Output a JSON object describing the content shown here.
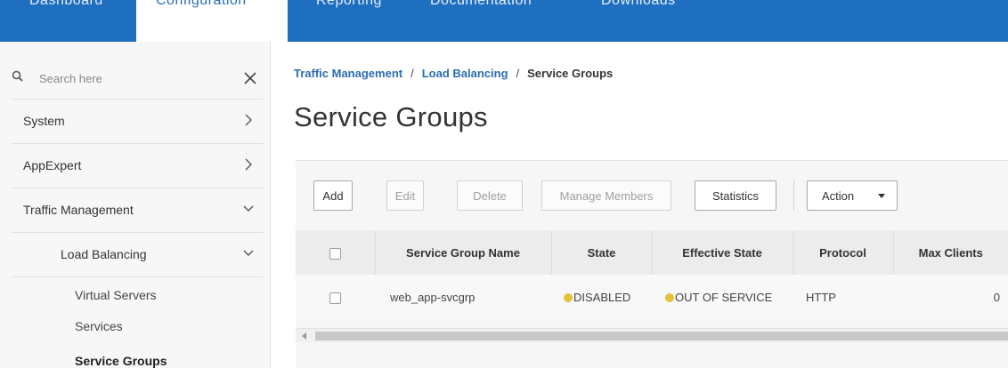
{
  "top_nav": {
    "tabs": [
      {
        "label": "Dashboard"
      },
      {
        "label": "Configuration"
      },
      {
        "label": "Reporting"
      },
      {
        "label": "Documentation"
      },
      {
        "label": "Downloads"
      }
    ],
    "active_tab": "Configuration",
    "background_color": "#1e6fbf"
  },
  "sidebar": {
    "search": {
      "placeholder": "Search here",
      "value": ""
    },
    "items": [
      {
        "label": "System",
        "expanded": false
      },
      {
        "label": "AppExpert",
        "expanded": false
      },
      {
        "label": "Traffic Management",
        "expanded": true
      },
      {
        "label": "Load Balancing",
        "expanded": true
      }
    ],
    "sub_items": [
      {
        "label": "Virtual Servers"
      },
      {
        "label": "Services"
      },
      {
        "label": "Service Groups",
        "active": true
      }
    ]
  },
  "breadcrumb": {
    "items": [
      "Traffic Management",
      "Load Balancing",
      "Service Groups"
    ],
    "separator": "/"
  },
  "page": {
    "title": "Service Groups"
  },
  "toolbar": {
    "add": "Add",
    "edit": "Edit",
    "delete": "Delete",
    "manage_members": "Manage Members",
    "statistics": "Statistics",
    "action": "Action"
  },
  "table": {
    "columns": [
      "",
      "Service Group Name",
      "State",
      "Effective State",
      "Protocol",
      "Max Clients"
    ],
    "rows": [
      {
        "name": "web_app-svcgrp",
        "state": "DISABLED",
        "effective_state": "OUT OF SERVICE",
        "protocol": "HTTP",
        "max_clients": "0",
        "status_color": "#e4c23a"
      }
    ]
  }
}
